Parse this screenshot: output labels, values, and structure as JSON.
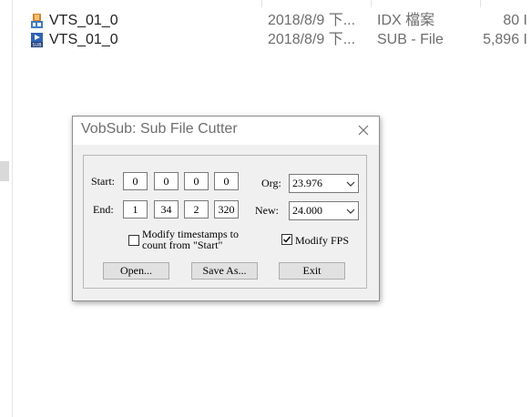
{
  "files": [
    {
      "name": "VTS_01_0",
      "date": "2018/8/9 下...",
      "type": "IDX 檔案",
      "size": "80 I",
      "icon": "idx-file-icon"
    },
    {
      "name": "VTS_01_0",
      "date": "2018/8/9 下...",
      "type": "SUB - File",
      "size": "5,896 I",
      "icon": "sub-file-icon"
    }
  ],
  "dialog": {
    "title": "VobSub: Sub File Cutter",
    "start_label": "Start:",
    "end_label": "End:",
    "start": [
      "0",
      "0",
      "0",
      "0"
    ],
    "end": [
      "1",
      "34",
      "2",
      "320"
    ],
    "org_label": "Org:",
    "new_label": "New:",
    "org_value": "23.976",
    "new_value": "24.000",
    "modify_timestamps_label_line1": "Modify timestamps to",
    "modify_timestamps_label_line2": "count from \"Start\"",
    "modify_timestamps_checked": false,
    "modify_fps_label": "Modify FPS",
    "modify_fps_checked": true,
    "open_label": "Open...",
    "save_label": "Save As...",
    "exit_label": "Exit"
  }
}
